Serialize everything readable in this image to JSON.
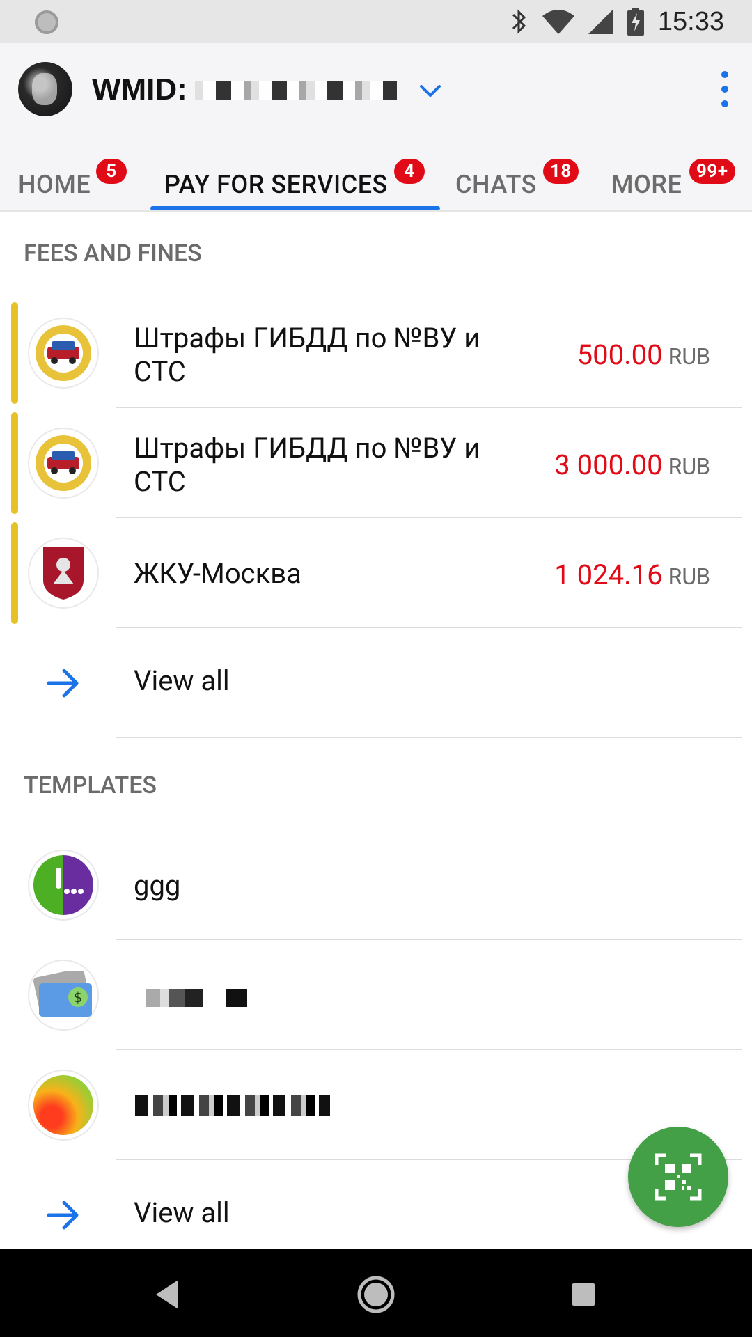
{
  "status_bar": {
    "time": "15:33"
  },
  "header": {
    "wmid_label": "WMID:"
  },
  "tabs": [
    {
      "label": "HOME",
      "badge": "5"
    },
    {
      "label": "PAY FOR SERVICES",
      "badge": "4"
    },
    {
      "label": "CHATS",
      "badge": "18"
    },
    {
      "label": "MORE",
      "badge": "99+"
    }
  ],
  "fees": {
    "title": "FEES AND FINES",
    "items": [
      {
        "name": "Штрафы ГИБДД по №ВУ и СТС",
        "amount": "500.00",
        "currency": "RUB"
      },
      {
        "name": "Штрафы ГИБДД по №ВУ и СТС",
        "amount": "3 000.00",
        "currency": "RUB"
      },
      {
        "name": "ЖКУ-Москва",
        "amount": "1 024.16",
        "currency": "RUB"
      }
    ],
    "view_all": "View all"
  },
  "templates": {
    "title": "TEMPLATES",
    "items": [
      {
        "name": "ggg"
      }
    ],
    "view_all": "View all"
  },
  "colors": {
    "accent": "#1a73e8",
    "badge": "#e10b17",
    "fab": "#43a047",
    "stripe": "#e6c229"
  },
  "icons": {
    "fab": "qr-scan-icon"
  }
}
